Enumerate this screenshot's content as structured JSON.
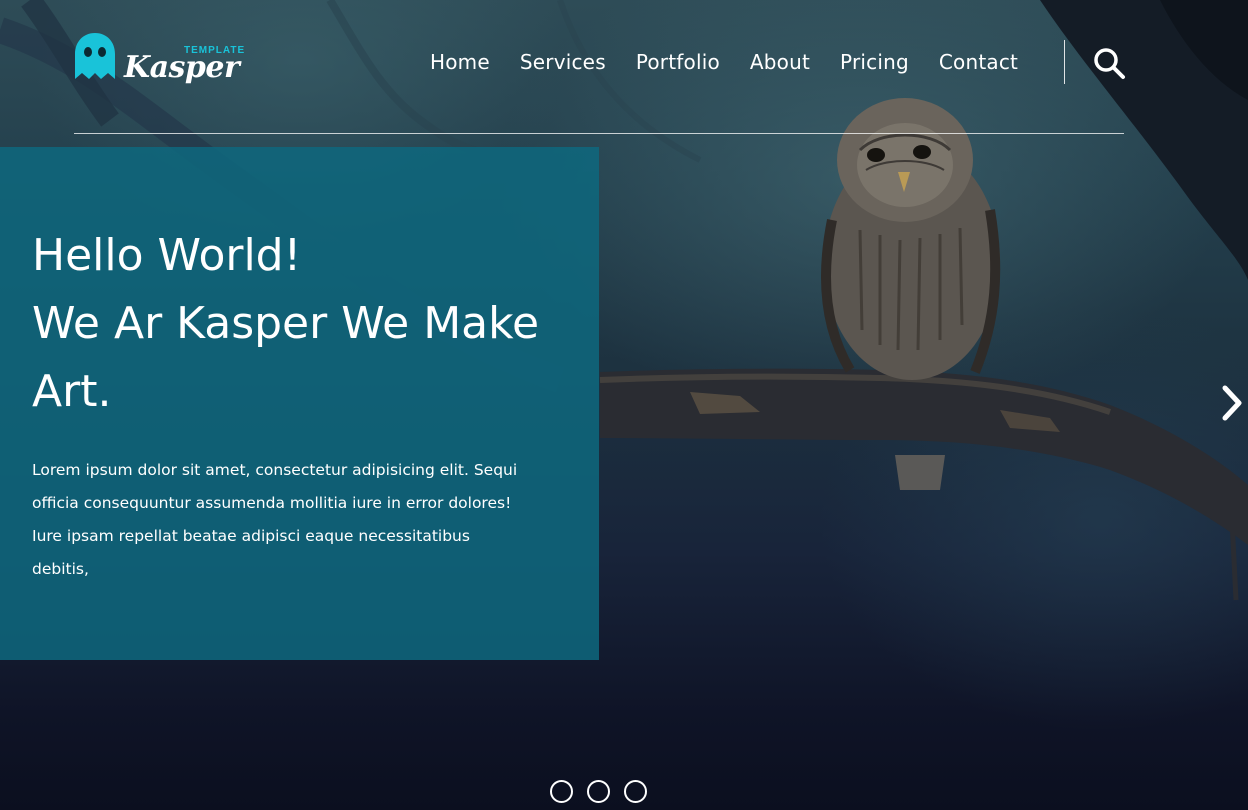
{
  "brand": {
    "tagline": "TEMPLATE",
    "name": "Kasper",
    "accent_color": "#19c3d9"
  },
  "nav": {
    "items": [
      {
        "label": "Home"
      },
      {
        "label": "Services"
      },
      {
        "label": "Portfolio"
      },
      {
        "label": "About"
      },
      {
        "label": "Pricing"
      },
      {
        "label": "Contact"
      }
    ],
    "search_icon": "search-icon"
  },
  "hero": {
    "headline_lines": [
      "Hello World!",
      "We Ar Kasper We Make",
      "Art."
    ],
    "description": "Lorem ipsum dolor sit amet, consectetur adipisicing elit. Sequi officia consequuntur assumenda mollitia iure in error dolores! Iure ipsam repellat beatae adipisci eaque necessitatibus debitis,",
    "panel_color": "#0e687e",
    "next_icon": "chevron-right-icon"
  },
  "slider": {
    "dot_count": 3
  }
}
